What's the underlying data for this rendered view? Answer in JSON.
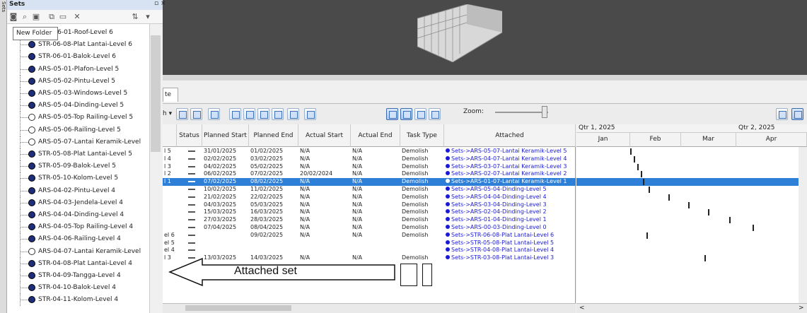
{
  "sets_panel": {
    "title": "Sets",
    "side_tab": "Sets",
    "close_glyph": "▫ ×",
    "tooltip": "New Folder",
    "items": [
      "ARS-06-01-Roof-Level 6",
      "STR-06-08-Plat Lantai-Level 6",
      "STR-06-01-Balok-Level 6",
      "ARS-05-01-Plafon-Level 5",
      "ARS-05-02-Pintu-Level 5",
      "ARS-05-03-Windows-Level 5",
      "ARS-05-04-Dinding-Level 5",
      "ARS-05-05-Top Railing-Level 5",
      "ARS-05-06-Railing-Level 5",
      "ARS-05-07-Lantai Keramik-Level",
      "STR-05-08-Plat Lantai-Level 5",
      "STR-05-09-Balok-Level 5",
      "STR-05-10-Kolom-Level 5",
      "ARS-04-02-Pintu-Level 4",
      "ARS-04-03-Jendela-Level 4",
      "ARS-04-04-Dinding-Level 4",
      "ARS-04-05-Top Railing-Level 4",
      "ARS-04-06-Railing-Level 4",
      "ARS-04-07-Lantai Keramik-Level",
      "STR-04-08-Plat Lantai-Level 4",
      "STR-04-09-Tangga-Level 4",
      "STR-04-10-Balok-Level 4",
      "STR-04-11-Kolom-Level 4"
    ],
    "open_items": [
      7,
      8,
      9,
      18
    ]
  },
  "timeliner": {
    "tab_label": "te",
    "zoom_label": "Zoom:",
    "columns": [
      "Status",
      "Planned Start",
      "Planned End",
      "Actual Start",
      "Actual End",
      "Task Type",
      "Attached"
    ],
    "rows": [
      {
        "name": "l 5",
        "ps": "31/01/2025",
        "pe": "01/02/2025",
        "as": "N/A",
        "ae": "N/A",
        "type": "Demolish",
        "att": "Sets->ARS-05-07-Lantai Keramik-Level 5"
      },
      {
        "name": "l 4",
        "ps": "02/02/2025",
        "pe": "03/02/2025",
        "as": "N/A",
        "ae": "N/A",
        "type": "Demolish",
        "att": "Sets->ARS-04-07-Lantai Keramik-Level 4"
      },
      {
        "name": "l 3",
        "ps": "04/02/2025",
        "pe": "05/02/2025",
        "as": "N/A",
        "ae": "N/A",
        "type": "Demolish",
        "att": "Sets->ARS-03-07-Lantai Keramik-Level 3"
      },
      {
        "name": "l 2",
        "ps": "06/02/2025",
        "pe": "07/02/2025",
        "as": "20/02/2024",
        "ae": "N/A",
        "type": "Demolish",
        "att": "Sets->ARS-02-07-Lantai Keramik-Level 2"
      },
      {
        "name": "l 1",
        "ps": "07/02/2025",
        "pe": "08/02/2025",
        "as": "N/A",
        "ae": "N/A",
        "type": "Demolish",
        "att": "Sets->ARS-01-07-Lantai Keramik-Level 1",
        "selected": true
      },
      {
        "name": "",
        "ps": "10/02/2025",
        "pe": "11/02/2025",
        "as": "N/A",
        "ae": "N/A",
        "type": "Demolish",
        "att": "Sets->ARS-05-04-Dinding-Level 5"
      },
      {
        "name": "",
        "ps": "21/02/2025",
        "pe": "22/02/2025",
        "as": "N/A",
        "ae": "N/A",
        "type": "Demolish",
        "att": "Sets->ARS-04-04-Dinding-Level 4"
      },
      {
        "name": "",
        "ps": "04/03/2025",
        "pe": "05/03/2025",
        "as": "N/A",
        "ae": "N/A",
        "type": "Demolish",
        "att": "Sets->ARS-03-04-Dinding-Level 3"
      },
      {
        "name": "",
        "ps": "15/03/2025",
        "pe": "16/03/2025",
        "as": "N/A",
        "ae": "N/A",
        "type": "Demolish",
        "att": "Sets->ARS-02-04-Dinding-Level 2"
      },
      {
        "name": "",
        "ps": "27/03/2025",
        "pe": "28/03/2025",
        "as": "N/A",
        "ae": "N/A",
        "type": "Demolish",
        "att": "Sets->ARS-01-04-Dinding-Level 1"
      },
      {
        "name": "",
        "ps": "07/04/2025",
        "pe": "08/04/2025",
        "as": "N/A",
        "ae": "N/A",
        "type": "Demolish",
        "att": "Sets->ARS-00-03-Dinding-Level 0"
      },
      {
        "name": "el 6",
        "ps": "",
        "pe": "09/02/2025",
        "as": "N/A",
        "ae": "N/A",
        "type": "Demolish",
        "att": "Sets->STR-06-08-Plat Lantai-Level 6"
      },
      {
        "name": "el 5",
        "ps": "",
        "pe": "",
        "as": "",
        "ae": "",
        "type": "",
        "att": "Sets->STR-05-08-Plat Lantai-Level 5"
      },
      {
        "name": "el 4",
        "ps": "",
        "pe": "",
        "as": "",
        "ae": "",
        "type": "",
        "att": "Sets->STR-04-08-Plat Lantai-Level 4"
      },
      {
        "name": "l 3",
        "ps": "13/03/2025",
        "pe": "14/03/2025",
        "as": "N/A",
        "ae": "N/A",
        "type": "Demolish",
        "att": "Sets->STR-03-08-Plat Lantai-Level 3"
      }
    ],
    "gantt": {
      "quarters": [
        "Qtr 1, 2025",
        "Qtr 2, 2025"
      ],
      "months": [
        "Jan",
        "Feb",
        "Mar",
        "Apr"
      ]
    }
  },
  "annotation": {
    "text": "Attached set"
  }
}
